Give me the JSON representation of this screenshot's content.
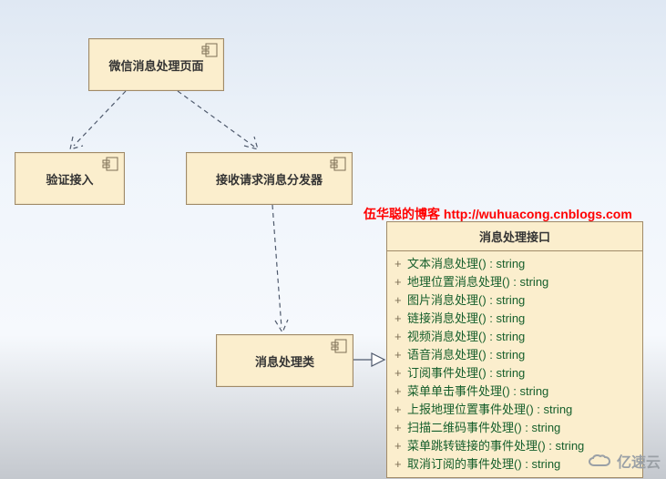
{
  "nodes": {
    "page": {
      "label": "微信消息处理页面"
    },
    "verify": {
      "label": "验证接入"
    },
    "dispatcher": {
      "label": "接收请求消息分发器"
    },
    "handler": {
      "label": "消息处理类"
    }
  },
  "interface": {
    "name": "消息处理接口",
    "operations": [
      {
        "vis": "+",
        "sig": "文本消息处理() : string"
      },
      {
        "vis": "+",
        "sig": "地理位置消息处理() : string"
      },
      {
        "vis": "+",
        "sig": "图片消息处理() : string"
      },
      {
        "vis": "+",
        "sig": "链接消息处理() : string"
      },
      {
        "vis": "+",
        "sig": "视频消息处理() : string"
      },
      {
        "vis": "+",
        "sig": "语音消息处理() : string"
      },
      {
        "vis": "+",
        "sig": "订阅事件处理() : string"
      },
      {
        "vis": "+",
        "sig": "菜单单击事件处理() : string"
      },
      {
        "vis": "+",
        "sig": "上报地理位置事件处理() : string"
      },
      {
        "vis": "+",
        "sig": "扫描二维码事件处理() : string"
      },
      {
        "vis": "+",
        "sig": "菜单跳转链接的事件处理() : string"
      },
      {
        "vis": "+",
        "sig": "取消订阅的事件处理() : string"
      }
    ]
  },
  "watermark": {
    "text": "伍华聪的博客 http://wuhuacong.cnblogs.com"
  },
  "logo": {
    "text": "亿速云"
  },
  "chart_data": {
    "type": "diagram",
    "title": "UML 组件/类图 — 微信消息处理",
    "nodes": [
      {
        "id": "page",
        "kind": "component",
        "label": "微信消息处理页面"
      },
      {
        "id": "verify",
        "kind": "component",
        "label": "验证接入"
      },
      {
        "id": "dispatcher",
        "kind": "component",
        "label": "接收请求消息分发器"
      },
      {
        "id": "handler",
        "kind": "component",
        "label": "消息处理类"
      },
      {
        "id": "iMsg",
        "kind": "interface",
        "label": "消息处理接口",
        "operations": [
          "文本消息处理() : string",
          "地理位置消息处理() : string",
          "图片消息处理() : string",
          "链接消息处理() : string",
          "视频消息处理() : string",
          "语音消息处理() : string",
          "订阅事件处理() : string",
          "菜单单击事件处理() : string",
          "上报地理位置事件处理() : string",
          "扫描二维码事件处理() : string",
          "菜单跳转链接的事件处理() : string",
          "取消订阅的事件处理() : string"
        ]
      }
    ],
    "edges": [
      {
        "from": "page",
        "to": "verify",
        "style": "dashed-arrow",
        "relation": "dependency"
      },
      {
        "from": "page",
        "to": "dispatcher",
        "style": "dashed-arrow",
        "relation": "dependency"
      },
      {
        "from": "dispatcher",
        "to": "handler",
        "style": "dashed-arrow",
        "relation": "dependency"
      },
      {
        "from": "handler",
        "to": "iMsg",
        "style": "hollow-triangle",
        "relation": "realization"
      }
    ]
  }
}
